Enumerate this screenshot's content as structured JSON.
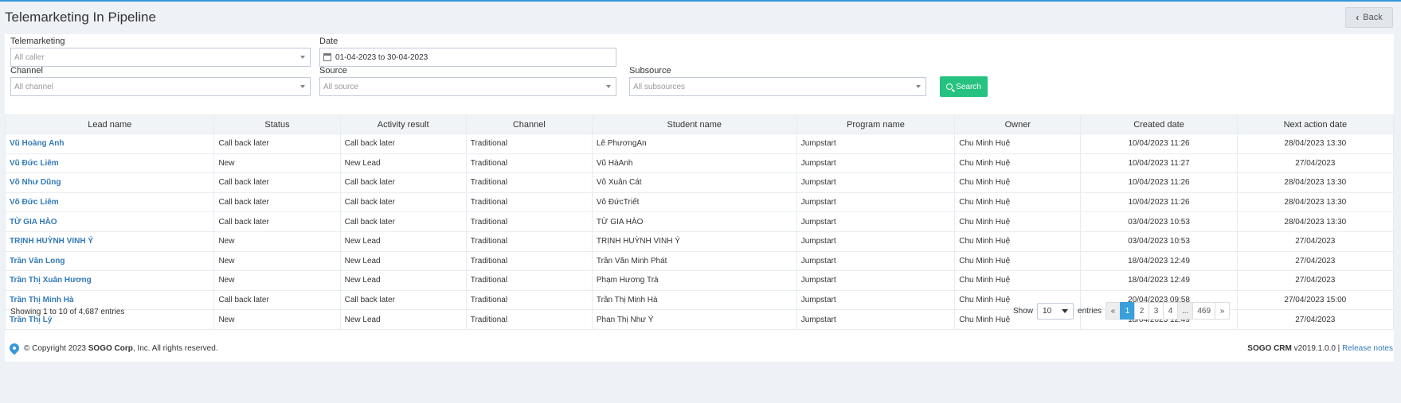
{
  "page": {
    "title": "Telemarketing In Pipeline",
    "back_label": "Back"
  },
  "filters": {
    "telemarketing": {
      "label": "Telemarketing",
      "placeholder": "All caller"
    },
    "date": {
      "label": "Date",
      "value": "01-04-2023 to 30-04-2023"
    },
    "channel": {
      "label": "Channel",
      "placeholder": "All channel"
    },
    "source": {
      "label": "Source",
      "placeholder": "All source"
    },
    "subsource": {
      "label": "Subsource",
      "placeholder": "All subsources"
    },
    "search_label": "Search"
  },
  "table": {
    "columns": [
      "Lead name",
      "Status",
      "Activity result",
      "Channel",
      "Student name",
      "Program name",
      "Owner",
      "Created date",
      "Next action date"
    ],
    "rows": [
      [
        "Vũ Hoàng Anh",
        "Call back later",
        "Call back later",
        "Traditional",
        "Lê PhươngAn",
        "Jumpstart",
        "Chu Minh Huệ",
        "10/04/2023 11:26",
        "28/04/2023 13:30"
      ],
      [
        "Vũ Đức Liêm",
        "New",
        "New Lead",
        "Traditional",
        "Vũ HàAnh",
        "Jumpstart",
        "Chu Minh Huệ",
        "10/04/2023 11:27",
        "27/04/2023"
      ],
      [
        "Võ Như Dũng",
        "Call back later",
        "Call back later",
        "Traditional",
        "Võ Xuân Cát",
        "Jumpstart",
        "Chu Minh Huệ",
        "10/04/2023 11:26",
        "28/04/2023 13:30"
      ],
      [
        "Võ Đức Liêm",
        "Call back later",
        "Call back later",
        "Traditional",
        "Võ ĐứcTriết",
        "Jumpstart",
        "Chu Minh Huệ",
        "10/04/2023 11:26",
        "28/04/2023 13:30"
      ],
      [
        "TỪ GIA HÀO",
        "Call back later",
        "Call back later",
        "Traditional",
        "TỪ GIA HÀO",
        "Jumpstart",
        "Chu Minh Huệ",
        "03/04/2023 10:53",
        "28/04/2023 13:30"
      ],
      [
        "TRỊNH HUỲNH VINH Ý",
        "New",
        "New Lead",
        "Traditional",
        "TRỊNH HUỲNH VINH Ý",
        "Jumpstart",
        "Chu Minh Huệ",
        "03/04/2023 10:53",
        "27/04/2023"
      ],
      [
        "Trần Văn Long",
        "New",
        "New Lead",
        "Traditional",
        "Trần Văn Minh Phát",
        "Jumpstart",
        "Chu Minh Huệ",
        "18/04/2023 12:49",
        "27/04/2023"
      ],
      [
        "Trần Thị Xuân Hương",
        "New",
        "New Lead",
        "Traditional",
        "Phạm Hương Trà",
        "Jumpstart",
        "Chu Minh Huệ",
        "18/04/2023 12:49",
        "27/04/2023"
      ],
      [
        "Trần Thị Minh Hà",
        "Call back later",
        "Call back later",
        "Traditional",
        "Trần Thị Minh Hà",
        "Jumpstart",
        "Chu Minh Huệ",
        "20/04/2023 09:58",
        "27/04/2023 15:00"
      ],
      [
        "Trần Thị Lý",
        "New",
        "New Lead",
        "Traditional",
        "Phan Thị Như Ý",
        "Jumpstart",
        "Chu Minh Huệ",
        "18/04/2023 12:49",
        "27/04/2023"
      ]
    ]
  },
  "pagination": {
    "info": "Showing 1 to 10 of 4,687 entries",
    "show_label": "Show",
    "page_length": "10",
    "entries_label": "entries",
    "prev": "«",
    "pages": [
      "1",
      "2",
      "3",
      "4",
      "...",
      "469"
    ],
    "next": "»"
  },
  "footer": {
    "copyright_prefix": "© Copyright 2023 ",
    "company": "SOGO Corp",
    "copyright_suffix": ", Inc. All rights reserved.",
    "product": "SOGO CRM",
    "version": " v2019.1.0.0 | ",
    "release_notes": "Release notes"
  },
  "colors": {
    "accent": "#3598dc",
    "search_button": "#26c281",
    "link": "#337ab7",
    "active_page": "#3aa0dc"
  }
}
